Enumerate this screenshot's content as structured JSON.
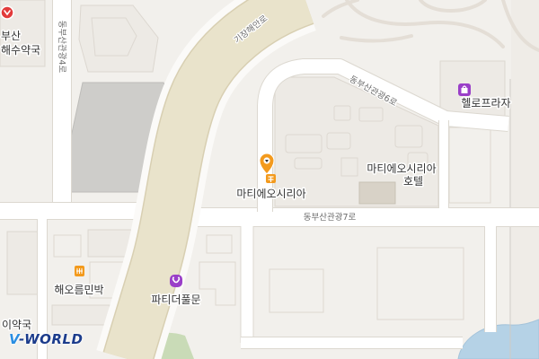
{
  "map": {
    "colors": {
      "background": "#f2f0ec",
      "road": "#ffffff",
      "main_road": "#e9e3cb",
      "water": "#b5d2e6",
      "park": "#c9dbb7",
      "parking": "#cecdca",
      "poi_orange": "#f39a1d",
      "poi_purple": "#9a3fc8",
      "poi_red": "#e23b3b",
      "logo_blue": "#2a8ee2"
    }
  },
  "road_labels": {
    "gijang_coast": "기장해안로",
    "dongbusan_4": "동부산관광4로",
    "dongbusan_6": "동부산관광6로",
    "dongbusan_7": "동부산관광7로"
  },
  "pois": {
    "matie_osiria": {
      "label": "마티에오시리아",
      "icon": "map-pin-icon",
      "category_icon": "hotel-icon"
    },
    "matie_hotel": {
      "line1": "마티에오시리아",
      "line2": "호텔"
    },
    "hello_plaza": {
      "label": "헬로프라자",
      "icon": "shopping-bag-icon"
    },
    "haeoreum": {
      "label": "해오름민박",
      "icon": "lodging-icon"
    },
    "party_fullmoon": {
      "label": "파티더풀문",
      "icon": "leisure-icon"
    },
    "busan_pharmacy": {
      "line1": "부산",
      "line2": "해수약국",
      "icon": "red-marker-icon"
    },
    "pharmacy_bottom": {
      "label": "이약국"
    }
  },
  "logo": {
    "text": "V-WORLD"
  }
}
